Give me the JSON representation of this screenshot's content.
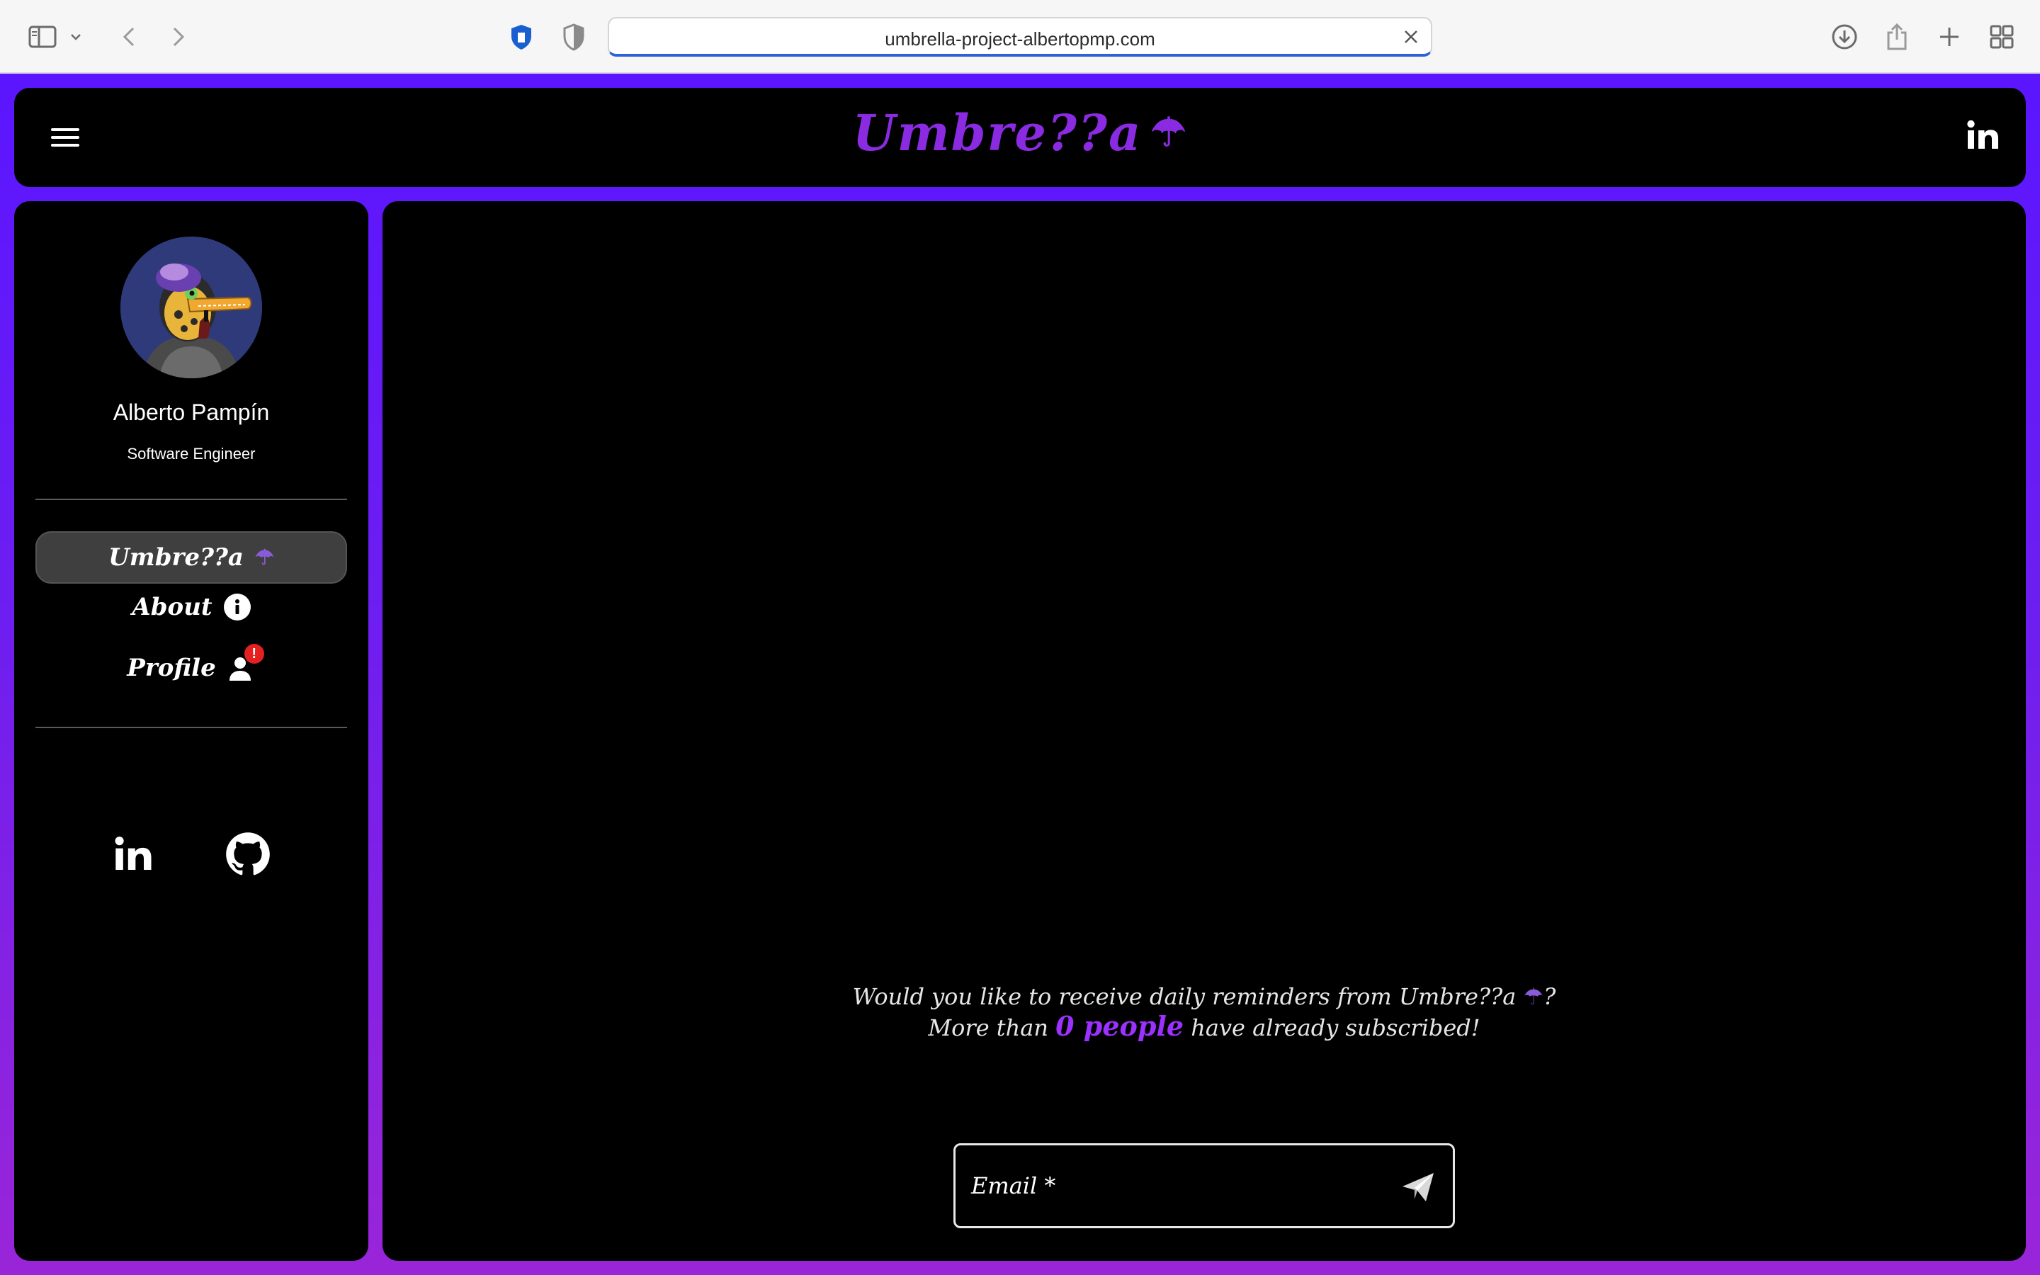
{
  "browser": {
    "url": "umbrella-project-albertopmp.com"
  },
  "header": {
    "brand_text": "Umbre??a",
    "brand_emoji": "☂"
  },
  "sidebar": {
    "profile": {
      "name": "Alberto Pampín",
      "role": "Software Engineer"
    },
    "nav": [
      {
        "label": "Umbre??a",
        "emoji": "☂",
        "active": true
      },
      {
        "label": "About",
        "icon": "info-icon"
      },
      {
        "label": "Profile",
        "icon": "user-icon",
        "badge": "!"
      }
    ],
    "social": [
      "linkedin-icon",
      "github-icon"
    ]
  },
  "main": {
    "subscribe": {
      "line1_prefix": "Would you like to receive daily reminders from Umbre??a",
      "line1_emoji": "☂",
      "line1_suffix": "?",
      "line2_prefix": "More than",
      "line2_highlight": "0 people",
      "line2_suffix": "have already subscribed!"
    },
    "email_label": "Email *"
  },
  "colors": {
    "accent": "#8a2be2",
    "gradient_top": "#5b16ff",
    "gradient_bottom": "#9a25d8",
    "badge": "#e42020"
  }
}
